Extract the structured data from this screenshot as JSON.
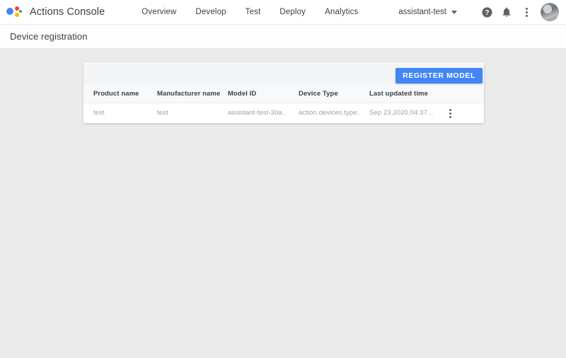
{
  "appbar": {
    "logo_icon": "google-assistant-logo",
    "brand_title": "Actions Console",
    "nav": [
      {
        "label": "Overview"
      },
      {
        "label": "Develop"
      },
      {
        "label": "Test"
      },
      {
        "label": "Deploy"
      },
      {
        "label": "Analytics"
      }
    ],
    "project": {
      "name": "assistant-test",
      "caret_icon": "chevron-down-icon"
    },
    "help_icon": "help-circle-icon",
    "notifications_icon": "bell-icon",
    "overflow_icon": "kebab-menu-icon",
    "avatar_icon": "user-avatar"
  },
  "titlebar": {
    "page_title": "Device registration"
  },
  "card": {
    "register_button": "REGISTER MODEL",
    "table": {
      "columns": [
        "Product name",
        "Manufacturer name",
        "Model ID",
        "Device Type",
        "Last updated time"
      ],
      "rows": [
        {
          "product_name": "test",
          "manufacturer_name": "test",
          "model_id": "assistant-test-30a..",
          "device_type": "action.devices.type..",
          "last_updated_time": "Sep 23,2020,04:37 ..",
          "row_menu_icon": "kebab-menu-icon"
        }
      ]
    }
  },
  "colors": {
    "accent_blue": "#4285f4",
    "logo_red": "#ea4335",
    "logo_yellow": "#fbbc05",
    "logo_green": "#34a853",
    "page_background": "#ebebeb",
    "surface": "#ffffff",
    "toolbar_gray": "#f4f5f6",
    "table_header_gray": "#f8f9fa",
    "text_primary": "#3c4043",
    "text_muted": "#9aa0a6"
  }
}
